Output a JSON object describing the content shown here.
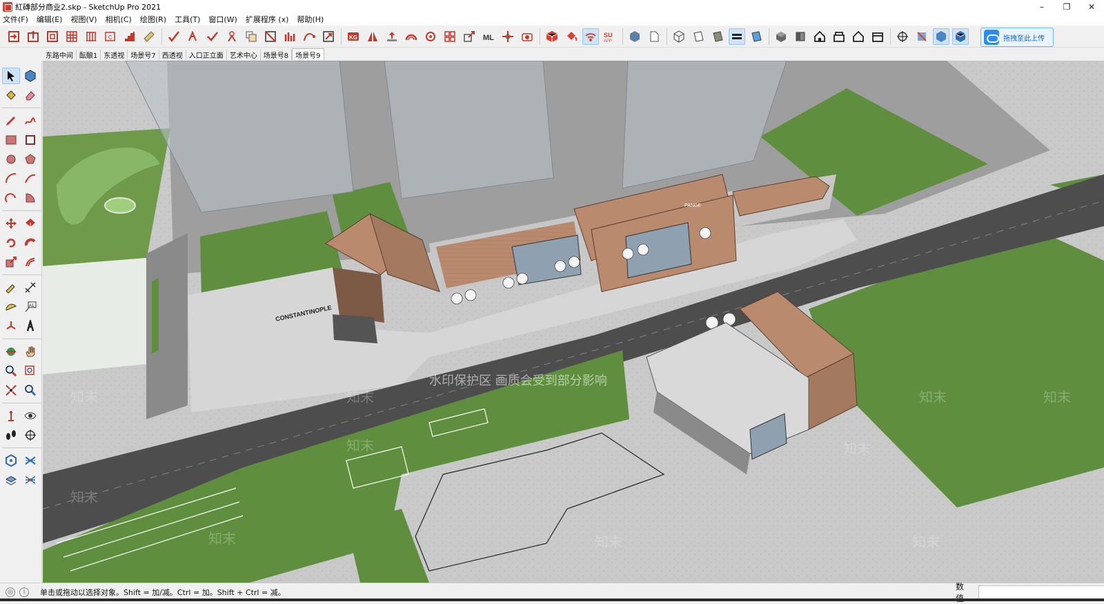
{
  "window": {
    "title": "紅磚部分商业2.skp - SketchUp Pro 2021",
    "controls": [
      "–",
      "❐",
      "✕"
    ]
  },
  "menu": [
    "文件(F)",
    "编辑(E)",
    "视图(V)",
    "相机(C)",
    "绘图(R)",
    "工具(T)",
    "窗口(W)",
    "扩展程序 (x)",
    "帮助(H)"
  ],
  "toolbar": {
    "upload_label": "拖拽至此上传",
    "su_app_label": "SU APP",
    "kg_label": "KG",
    "ml_label": "ML"
  },
  "scenes": {
    "tabs": [
      "东路中间",
      "酝酿1",
      "东透视",
      "场景号7",
      "西透视",
      "入口正立面",
      "艺术中心",
      "场景号8",
      "场景号9"
    ],
    "active": "场景号9"
  },
  "viewport": {
    "sign_text": "CONSTANTINOPLE",
    "sign_text_2": "PANGE",
    "watermark_text": "水印保护区   画质会受到部分影响",
    "watermark_brand": "知末"
  },
  "status": {
    "message": "单击或拖动以选择对象。Shift = 加/减。Ctrl = 加。Shift + Ctrl = 减。",
    "measure_label": "数值",
    "measure_value": ""
  },
  "colors": {
    "brick": "#b98a6e",
    "grass": "#5f8f3e",
    "road": "#4d4d4d",
    "glass": "#a7b2bc"
  }
}
